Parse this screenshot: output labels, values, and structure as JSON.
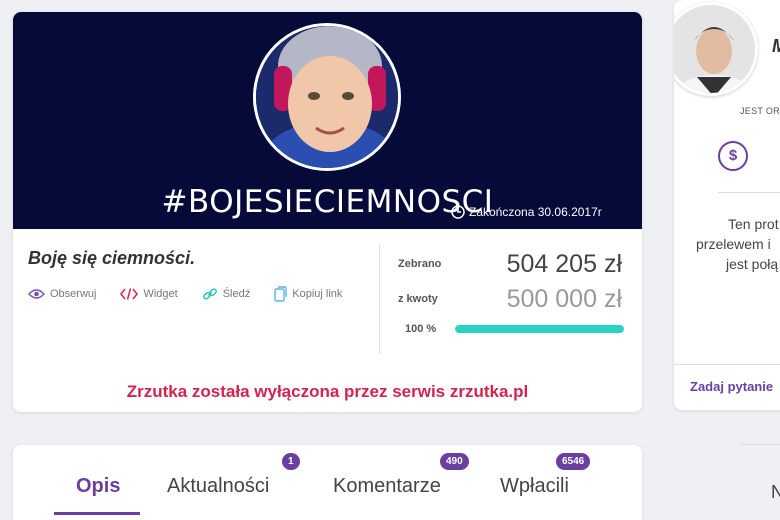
{
  "campaign": {
    "banner_title": "#BOJESIECIEMNOSCI",
    "status_text": "Zakończona 30.06.2017r",
    "title": "Boję się ciemności.",
    "actions": [
      {
        "label": "Obserwuj",
        "icon": "eye-icon"
      },
      {
        "label": "Widget",
        "icon": "code-icon"
      },
      {
        "label": "Śledź",
        "icon": "link-icon"
      },
      {
        "label": "Kopiuj link",
        "icon": "copy-icon"
      }
    ],
    "collected_label": "Zebrano",
    "collected_value": "504 205 zł",
    "goal_label": "z kwoty",
    "goal_value": "500 000 zł",
    "percent_label": "100 %",
    "progress_fraction": 1.0,
    "disabled_notice": "Zrzutka została wyłączona przez serwis zrzutka.pl"
  },
  "tabs": [
    {
      "label": "Opis",
      "active": true
    },
    {
      "label": "Aktualności",
      "badge": "1"
    },
    {
      "label": "Komentarze",
      "badge": "490"
    },
    {
      "label": "Wpłacili",
      "badge": "6546"
    }
  ],
  "sidebar": {
    "initial": "M",
    "status": "JEST OR",
    "text_line1": "Ten prot",
    "text_line2": "przelewem i",
    "text_line3": "jest połą",
    "ask_link": "Zadaj pytanie",
    "bottom_letter": "N"
  },
  "colors": {
    "accent": "#6b3fa0",
    "banner_bg": "#050a38",
    "progress": "#29d3c2",
    "notice": "#d6234e"
  }
}
